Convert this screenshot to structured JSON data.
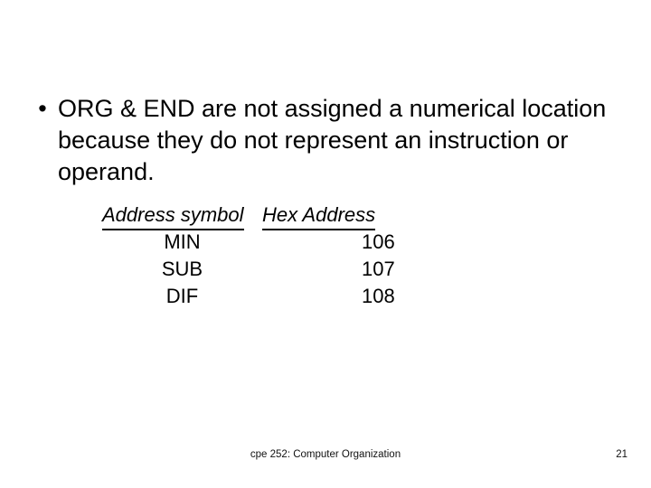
{
  "slide": {
    "bullets": [
      {
        "marker": "•",
        "text": "ORG & END are not assigned a numerical location because they do not represent an instruction or operand."
      }
    ],
    "table": {
      "headers": {
        "symbol": "Address symbol",
        "hex": "Hex Address"
      },
      "rows": [
        {
          "symbol": "MIN",
          "hex": "106"
        },
        {
          "symbol": "SUB",
          "hex": "107"
        },
        {
          "symbol": "DIF",
          "hex": "108"
        }
      ]
    },
    "footer": {
      "course": "cpe 252: Computer Organization",
      "page_number": "21"
    }
  }
}
